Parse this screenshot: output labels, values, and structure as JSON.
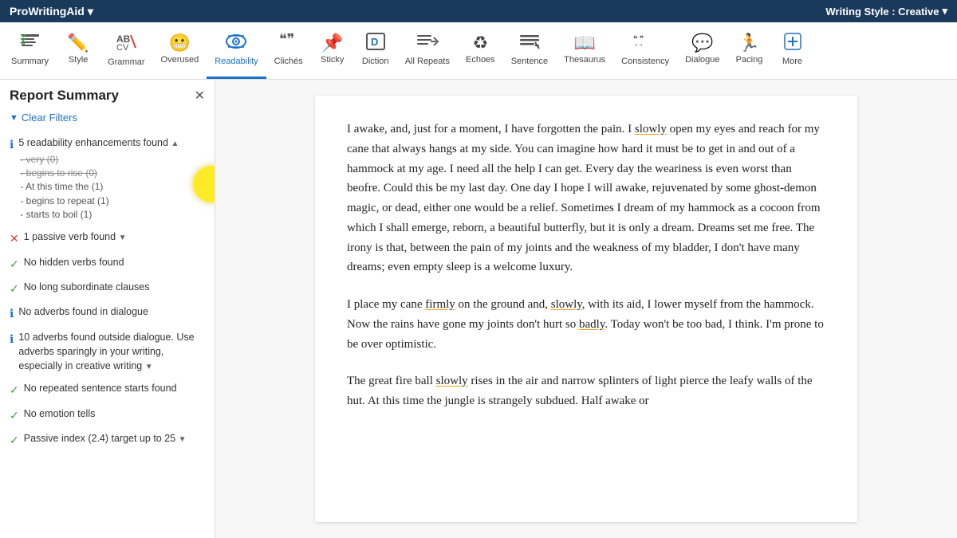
{
  "topbar": {
    "app_name": "ProWritingAid",
    "chevron": "▾",
    "writing_style_label": "Writing Style : Creative",
    "writing_style_chevron": "▾"
  },
  "toolbar": {
    "items": [
      {
        "id": "summary",
        "label": "Summary",
        "icon": "☰✓",
        "active": false
      },
      {
        "id": "style",
        "label": "Style",
        "icon": "✏️",
        "active": false
      },
      {
        "id": "grammar",
        "label": "Grammar",
        "icon": "AB\nCV",
        "active": false
      },
      {
        "id": "overused",
        "label": "Overused",
        "icon": "😬",
        "active": false
      },
      {
        "id": "readability",
        "label": "Readability",
        "icon": "👁",
        "active": true
      },
      {
        "id": "cliches",
        "label": "Clichés",
        "icon": "❝❞",
        "active": false
      },
      {
        "id": "sticky",
        "label": "Sticky",
        "icon": "📌",
        "active": false
      },
      {
        "id": "diction",
        "label": "Diction",
        "icon": "D",
        "active": false
      },
      {
        "id": "repeats",
        "label": "All Repeats",
        "icon": "≡⟳",
        "active": false
      },
      {
        "id": "echoes",
        "label": "Echoes",
        "icon": "♻",
        "active": false
      },
      {
        "id": "sentence",
        "label": "Sentence",
        "icon": "≡—",
        "active": false
      },
      {
        "id": "thesaurus",
        "label": "Thesaurus",
        "icon": "📖",
        "active": false
      },
      {
        "id": "consistency",
        "label": "Consistency",
        "icon": "❝ ❞\n\" \"",
        "active": false
      },
      {
        "id": "dialogue",
        "label": "Dialogue",
        "icon": "💬",
        "active": false
      },
      {
        "id": "pacing",
        "label": "Pacing",
        "icon": "🏃",
        "active": false
      },
      {
        "id": "more",
        "label": "More",
        "icon": "➕",
        "active": false
      }
    ]
  },
  "sidebar": {
    "title": "Report Summary",
    "close_label": "✕",
    "clear_filters_label": "Clear Filters",
    "filter_icon": "▼",
    "items": [
      {
        "id": "readability-enhancements",
        "icon_type": "info",
        "text": "5 readability enhancements found",
        "has_dropdown": true,
        "dropdown_state": "open",
        "sub_items": [
          {
            "text": "very (0)",
            "strikethrough": true
          },
          {
            "text": "begins to rise (0)",
            "strikethrough": true
          },
          {
            "text": "At this time the (1)",
            "strikethrough": false
          },
          {
            "text": "begins to repeat (1)",
            "strikethrough": false
          },
          {
            "text": "starts to boil (1)",
            "strikethrough": false
          }
        ]
      },
      {
        "id": "passive-verb",
        "icon_type": "error",
        "text": "1 passive verb found",
        "has_dropdown": true,
        "dropdown_state": "collapsed"
      },
      {
        "id": "hidden-verbs",
        "icon_type": "success",
        "text": "No hidden verbs found",
        "has_dropdown": false
      },
      {
        "id": "long-subordinate",
        "icon_type": "success",
        "text": "No long subordinate clauses",
        "has_dropdown": false
      },
      {
        "id": "adverbs-dialogue",
        "icon_type": "info",
        "text": "No adverbs found in dialogue",
        "has_dropdown": false
      },
      {
        "id": "adverbs-outside",
        "icon_type": "info",
        "text": "10 adverbs found outside dialogue. Use adverbs sparingly in your writing, especially in creative writing",
        "has_dropdown": true,
        "dropdown_state": "collapsed"
      },
      {
        "id": "repeated-sentence-starts",
        "icon_type": "success",
        "text": "No repeated sentence starts found",
        "has_dropdown": false
      },
      {
        "id": "emotion-tells",
        "icon_type": "success",
        "text": "No emotion tells",
        "has_dropdown": false
      },
      {
        "id": "passive-index",
        "icon_type": "success",
        "text": "Passive index (2.4) target up to 25",
        "has_dropdown": true,
        "dropdown_state": "collapsed"
      }
    ]
  },
  "document": {
    "paragraphs": [
      {
        "id": "p1",
        "segments": [
          {
            "text": "I awake, and, just for a moment, I have forgotten the pain. I ",
            "type": "normal"
          },
          {
            "text": "slowly",
            "type": "adverb"
          },
          {
            "text": " open my eyes and reach for my cane that always hangs at my side. You can imagine how hard it must be to get in and out of a hammock at my age. I need all the help I can get. Every day the weariness is even worst than beofre. Could this be my last day. One day I hope I will awake, rejuvenated by some ghost-demon magic, or dead, either one would be a relief. Sometimes I dream of my hammock as a cocoon from which I shall emerge, reborn, a beautiful butterfly, but it is only a dream. Dreams set me free. The irony is that, between the pain of my joints and the weakness of my bladder, I don't have many dreams; even empty sleep is a welcome luxury.",
            "type": "normal"
          }
        ]
      },
      {
        "id": "p2",
        "segments": [
          {
            "text": "I place my cane ",
            "type": "normal"
          },
          {
            "text": "firmly",
            "type": "adverb"
          },
          {
            "text": " on the ground and, ",
            "type": "normal"
          },
          {
            "text": "slowly",
            "type": "adverb"
          },
          {
            "text": ", with its aid, I lower myself from the hammock. Now the rains have gone my joints don't hurt so ",
            "type": "normal"
          },
          {
            "text": "badly",
            "type": "adverb"
          },
          {
            "text": ". Today won't be too bad, I think. I'm prone to be over optimistic.",
            "type": "normal"
          }
        ]
      },
      {
        "id": "p3",
        "segments": [
          {
            "text": "The great fire ball ",
            "type": "normal"
          },
          {
            "text": "slowly",
            "type": "adverb"
          },
          {
            "text": " rises in the air and narrow splinters of light pierce the leafy walls of the hut. At this time the jungle is strangely subdued. Half awake or",
            "type": "normal"
          }
        ]
      }
    ]
  }
}
